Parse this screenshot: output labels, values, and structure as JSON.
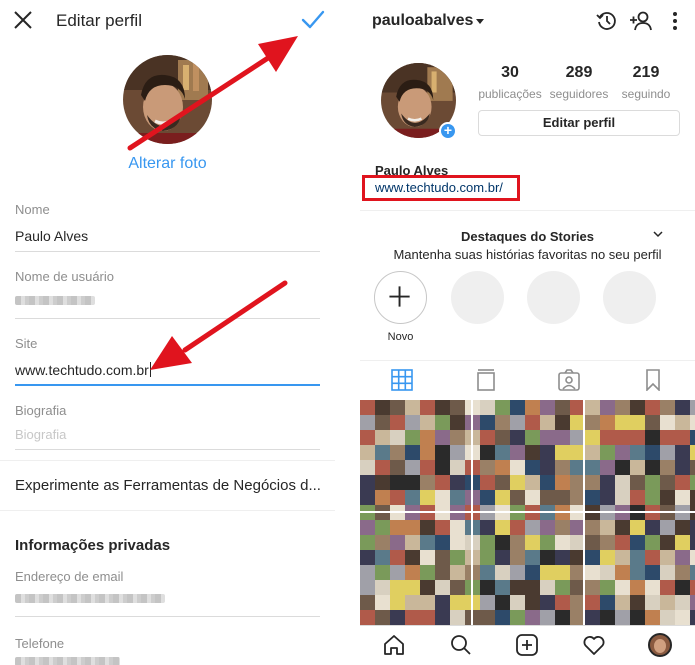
{
  "edit_profile": {
    "title": "Editar perfil",
    "change_photo": "Alterar foto",
    "fields": {
      "name_label": "Nome",
      "name_value": "Paulo Alves",
      "username_label": "Nome de usuário",
      "site_label": "Site",
      "site_value": "www.techtudo.com.br",
      "bio_label": "Biografia",
      "bio_placeholder": "Biografia"
    },
    "business_tools": "Experimente as Ferramentas de Negócios d...",
    "private_info_heading": "Informações privadas",
    "email_label": "Endereço de email",
    "phone_label": "Telefone"
  },
  "profile": {
    "username": "pauloabalves",
    "stats": [
      {
        "value": "30",
        "label": "publicações"
      },
      {
        "value": "289",
        "label": "seguidores"
      },
      {
        "value": "219",
        "label": "seguindo"
      }
    ],
    "edit_button": "Editar perfil",
    "display_name": "Paulo Alves",
    "website": "www.techtudo.com.br/",
    "highlights": {
      "title": "Destaques do Stories",
      "subtitle": "Mantenha suas histórias favoritas no seu perfil",
      "new_label": "Novo"
    }
  },
  "icons": {
    "left_top": [
      "close-icon",
      "check-icon"
    ],
    "right_top": [
      "archive-icon",
      "discover-people-icon",
      "more-options-icon"
    ],
    "tabs": [
      "grid-icon",
      "igtv-icon",
      "tagged-icon",
      "saved-icon"
    ],
    "bottom_nav": [
      "home-icon",
      "search-icon",
      "new-post-icon",
      "activity-icon",
      "profile-icon"
    ]
  },
  "colors": {
    "accent_blue": "#3897f0",
    "highlight_red": "#e0141e",
    "text_primary": "#262626",
    "text_secondary": "#8e8e8e",
    "divider": "#dbdbdb"
  }
}
